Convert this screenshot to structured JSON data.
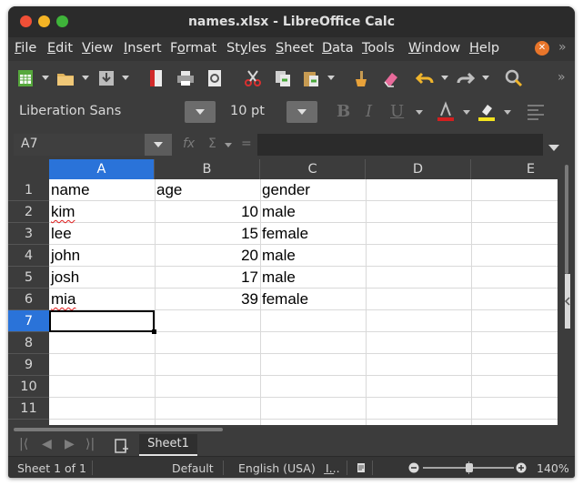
{
  "window": {
    "title": "names.xlsx - LibreOffice Calc"
  },
  "menu": {
    "items": [
      {
        "first": "F",
        "rest": "ile"
      },
      {
        "first": "E",
        "rest": "dit"
      },
      {
        "first": "V",
        "rest": "iew"
      },
      {
        "first": "I",
        "rest": "nsert"
      },
      {
        "first": "",
        "pre": "F",
        "under": "o",
        "rest": "rmat"
      },
      {
        "first": "",
        "pre": "St",
        "under": "y",
        "rest": "les"
      },
      {
        "first": "S",
        "rest": "heet"
      },
      {
        "first": "D",
        "rest": "ata"
      },
      {
        "first": "T",
        "rest": "ools"
      },
      {
        "first": "W",
        "rest": "indow"
      },
      {
        "first": "H",
        "rest": "elp"
      }
    ]
  },
  "format": {
    "font_name": "Liberation Sans",
    "font_size": "10 pt"
  },
  "formula": {
    "cell_ref": "A7",
    "fx": "fx",
    "sigma": "Σ",
    "equals": "="
  },
  "grid": {
    "columns": [
      "A",
      "B",
      "C",
      "D",
      "E"
    ],
    "rows": [
      "1",
      "2",
      "3",
      "4",
      "5",
      "6",
      "7",
      "8",
      "9",
      "10",
      "11"
    ],
    "data": [
      {
        "a": "name",
        "b": "age",
        "c": "gender"
      },
      {
        "a": "kim",
        "b": "10",
        "c": "male"
      },
      {
        "a": "lee",
        "b": "15",
        "c": "female"
      },
      {
        "a": "john",
        "b": "20",
        "c": "male"
      },
      {
        "a": "josh",
        "b": "17",
        "c": "male"
      },
      {
        "a": "mia",
        "b": "39",
        "c": "female"
      }
    ],
    "active_cell": "A7"
  },
  "tabs": {
    "sheet1": "Sheet1"
  },
  "status": {
    "sheet_info": "Sheet 1 of 1",
    "page_style": "Default",
    "language": "English (USA)",
    "zoom": "140%"
  },
  "colors": {
    "accent": "#2a73d9",
    "spell_error": "#e01b1b"
  }
}
